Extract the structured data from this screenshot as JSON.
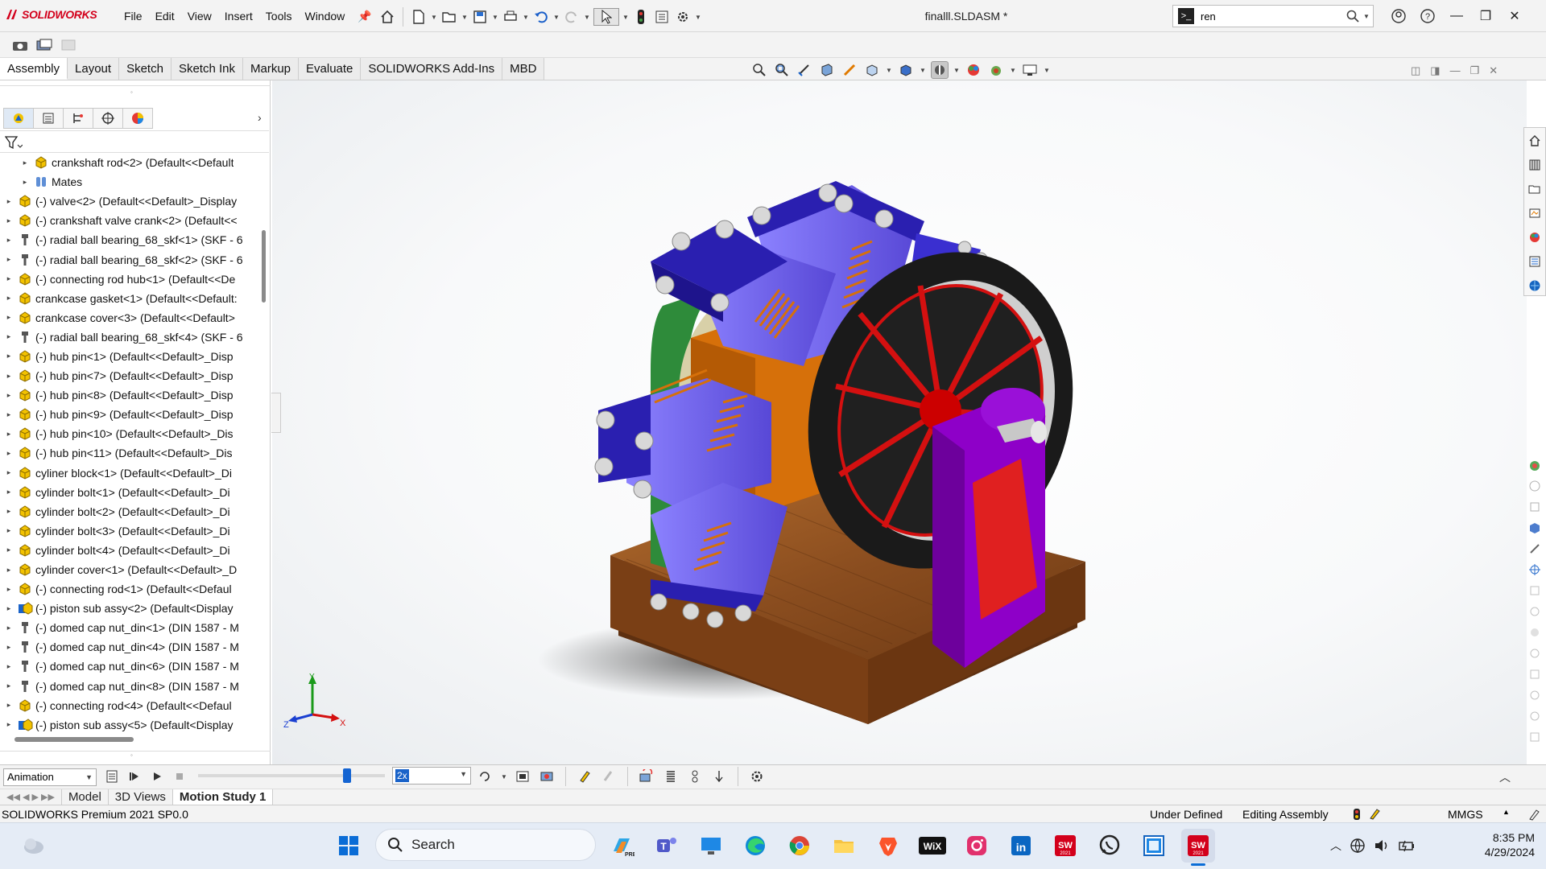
{
  "app": {
    "brand": "SOLIDWORKS",
    "document_title": "finalll.SLDASM *",
    "accent": "#d3001b"
  },
  "menu": [
    "File",
    "Edit",
    "View",
    "Insert",
    "Tools",
    "Window"
  ],
  "search": {
    "value": "ren",
    "icon": "command-search-icon"
  },
  "tabs": [
    {
      "label": "Assembly",
      "active": true
    },
    {
      "label": "Layout"
    },
    {
      "label": "Sketch"
    },
    {
      "label": "Sketch Ink"
    },
    {
      "label": "Markup"
    },
    {
      "label": "Evaluate"
    },
    {
      "label": "SOLIDWORKS Add-Ins"
    },
    {
      "label": "MBD"
    }
  ],
  "tree": {
    "items": [
      {
        "label": "crankshaft rod<2> (Default<<Default",
        "icon": "part-icon",
        "indent": 2
      },
      {
        "label": "Mates",
        "icon": "mates-icon",
        "indent": 2
      },
      {
        "label": "(-) valve<2> (Default<<Default>_Display",
        "icon": "part-icon",
        "indent": 1
      },
      {
        "label": "(-) crankshaft valve crank<2> (Default<<",
        "icon": "part-icon",
        "indent": 1
      },
      {
        "label": "(-) radial ball bearing_68_skf<1> (SKF - 6",
        "icon": "toolbox-icon",
        "indent": 1
      },
      {
        "label": "(-) radial ball bearing_68_skf<2> (SKF - 6",
        "icon": "toolbox-icon",
        "indent": 1
      },
      {
        "label": "(-) connecting rod hub<1> (Default<<De",
        "icon": "part-icon",
        "indent": 1
      },
      {
        "label": "crankcase gasket<1> (Default<<Default:",
        "icon": "part-icon",
        "indent": 1
      },
      {
        "label": "crankcase cover<3> (Default<<Default>",
        "icon": "part-icon",
        "indent": 1
      },
      {
        "label": "(-) radial ball bearing_68_skf<4> (SKF - 6",
        "icon": "toolbox-icon",
        "indent": 1
      },
      {
        "label": "(-) hub pin<1> (Default<<Default>_Disp",
        "icon": "part-icon",
        "indent": 1
      },
      {
        "label": "(-) hub pin<7> (Default<<Default>_Disp",
        "icon": "part-icon",
        "indent": 1
      },
      {
        "label": "(-) hub pin<8> (Default<<Default>_Disp",
        "icon": "part-icon",
        "indent": 1
      },
      {
        "label": "(-) hub pin<9> (Default<<Default>_Disp",
        "icon": "part-icon",
        "indent": 1
      },
      {
        "label": "(-) hub pin<10> (Default<<Default>_Dis",
        "icon": "part-icon",
        "indent": 1
      },
      {
        "label": "(-) hub pin<11> (Default<<Default>_Dis",
        "icon": "part-icon",
        "indent": 1
      },
      {
        "label": "cyliner block<1> (Default<<Default>_Di",
        "icon": "part-icon",
        "indent": 1
      },
      {
        "label": "cylinder bolt<1> (Default<<Default>_Di",
        "icon": "part-icon",
        "indent": 1
      },
      {
        "label": "cylinder bolt<2> (Default<<Default>_Di",
        "icon": "part-icon",
        "indent": 1
      },
      {
        "label": "cylinder bolt<3> (Default<<Default>_Di",
        "icon": "part-icon",
        "indent": 1
      },
      {
        "label": "cylinder bolt<4> (Default<<Default>_Di",
        "icon": "part-icon",
        "indent": 1
      },
      {
        "label": "cylinder cover<1> (Default<<Default>_D",
        "icon": "part-icon",
        "indent": 1
      },
      {
        "label": "(-) connecting rod<1> (Default<<Defaul",
        "icon": "part-icon",
        "indent": 1
      },
      {
        "label": "(-) piston sub assy<2> (Default<Display",
        "icon": "subassembly-icon",
        "indent": 1
      },
      {
        "label": "(-) domed cap nut_din<1> (DIN 1587 - M",
        "icon": "toolbox-icon",
        "indent": 1
      },
      {
        "label": "(-) domed cap nut_din<4> (DIN 1587 - M",
        "icon": "toolbox-icon",
        "indent": 1
      },
      {
        "label": "(-) domed cap nut_din<6> (DIN 1587 - M",
        "icon": "toolbox-icon",
        "indent": 1
      },
      {
        "label": "(-) domed cap nut_din<8> (DIN 1587 - M",
        "icon": "toolbox-icon",
        "indent": 1
      },
      {
        "label": "(-) connecting rod<4> (Default<<Defaul",
        "icon": "part-icon",
        "indent": 1
      },
      {
        "label": "(-) piston sub assy<5> (Default<Display",
        "icon": "subassembly-icon",
        "indent": 1
      }
    ]
  },
  "motion": {
    "study_type": "Animation",
    "speed": "2x"
  },
  "bottom_tabs": [
    {
      "label": "Model"
    },
    {
      "label": "3D Views"
    },
    {
      "label": "Motion Study 1",
      "active": true
    }
  ],
  "status": {
    "product": "SOLIDWORKS Premium 2021 SP0.0",
    "definition": "Under Defined",
    "mode": "Editing Assembly",
    "units": "MMGS"
  },
  "taskbar": {
    "search_label": "Search",
    "time": "8:35 PM",
    "date": "4/29/2024",
    "apps": [
      "copilot-icon",
      "teams-icon",
      "desktop-icon",
      "edge-icon",
      "chrome-icon",
      "file-explorer-icon",
      "brave-icon",
      "wix-icon",
      "instagram-icon",
      "linkedin-icon",
      "solidworks-2021-icon",
      "whatsapp-icon",
      "store-icon",
      "solidworks-active-icon"
    ]
  },
  "triad": {
    "x": "X",
    "y": "Y",
    "z": "Z"
  }
}
